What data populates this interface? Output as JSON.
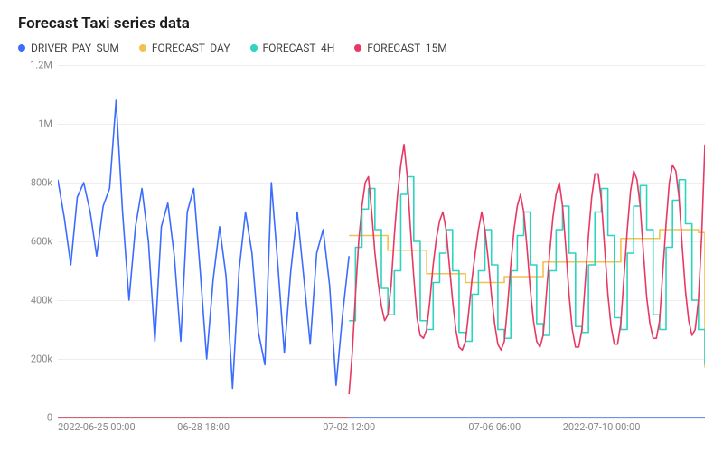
{
  "chart_data": {
    "type": "line",
    "title": "Forecast Taxi series data",
    "ylabel": "",
    "xlabel": "",
    "ylim": [
      0,
      1200000
    ],
    "y_ticks": [
      0,
      200000,
      400000,
      600000,
      800000,
      1000000,
      1200000
    ],
    "y_tick_labels": [
      "0",
      "200k",
      "400k",
      "600k",
      "800k",
      "1M",
      "1.2M"
    ],
    "x_ticks": [
      "2022-06-25 00:00",
      "06-28 18:00",
      "07-02 12:00",
      "07-06 06:00",
      "2022-07-10 00:00"
    ],
    "x_range_hours": 400,
    "legend_position": "top",
    "grid": true,
    "series": [
      {
        "name": "DRIVER_PAY_SUM",
        "color": "#3b6cff",
        "x_hours": [
          0,
          4,
          8,
          12,
          16,
          20,
          24,
          28,
          32,
          36,
          40,
          44,
          48,
          52,
          56,
          60,
          64,
          68,
          72,
          76,
          80,
          84,
          88,
          92,
          96,
          100,
          104,
          108,
          112,
          116,
          120,
          124,
          128,
          132,
          136,
          140,
          144,
          148,
          152,
          156,
          160,
          164,
          168,
          172,
          176,
          180
        ],
        "values": [
          810000,
          680000,
          520000,
          750000,
          800000,
          700000,
          550000,
          720000,
          780000,
          1080000,
          700000,
          400000,
          650000,
          780000,
          600000,
          260000,
          650000,
          730000,
          550000,
          260000,
          700000,
          780000,
          500000,
          200000,
          470000,
          650000,
          480000,
          100000,
          500000,
          700000,
          560000,
          290000,
          180000,
          800000,
          520000,
          220000,
          500000,
          700000,
          480000,
          250000,
          560000,
          640000,
          450000,
          110000,
          350000,
          550000
        ]
      },
      {
        "name": "FORECAST_DAY",
        "color": "#f2c14e",
        "step": true,
        "x_hours": [
          180,
          204,
          228,
          252,
          276,
          300,
          324,
          348,
          372,
          396,
          400
        ],
        "values": [
          620000,
          570000,
          490000,
          460000,
          480000,
          530000,
          530000,
          610000,
          640000,
          630000,
          170000
        ]
      },
      {
        "name": "FORECAST_4H",
        "color": "#2dd4bf",
        "step": true,
        "x_hours": [
          180,
          184,
          188,
          192,
          196,
          200,
          204,
          208,
          212,
          216,
          220,
          224,
          228,
          232,
          236,
          240,
          244,
          248,
          252,
          256,
          260,
          264,
          268,
          272,
          276,
          280,
          284,
          288,
          292,
          296,
          300,
          304,
          308,
          312,
          316,
          320,
          324,
          328,
          332,
          336,
          340,
          344,
          348,
          352,
          356,
          360,
          364,
          368,
          372,
          376,
          380,
          384,
          388,
          392,
          396,
          400
        ],
        "values": [
          330000,
          580000,
          710000,
          780000,
          640000,
          440000,
          350000,
          500000,
          760000,
          820000,
          600000,
          330000,
          300000,
          460000,
          560000,
          640000,
          500000,
          290000,
          260000,
          420000,
          500000,
          640000,
          520000,
          300000,
          270000,
          500000,
          620000,
          700000,
          520000,
          320000,
          280000,
          500000,
          640000,
          720000,
          560000,
          310000,
          290000,
          520000,
          700000,
          780000,
          620000,
          340000,
          300000,
          560000,
          720000,
          790000,
          640000,
          350000,
          300000,
          580000,
          740000,
          810000,
          660000,
          400000,
          300000,
          180000
        ]
      },
      {
        "name": "FORECAST_15M",
        "color": "#e63963",
        "x_hours": [
          180,
          182,
          184,
          186,
          188,
          190,
          192,
          194,
          196,
          198,
          200,
          202,
          204,
          206,
          208,
          210,
          212,
          214,
          216,
          218,
          220,
          222,
          224,
          226,
          228,
          230,
          232,
          234,
          236,
          238,
          240,
          242,
          244,
          246,
          248,
          250,
          252,
          254,
          256,
          258,
          260,
          262,
          264,
          266,
          268,
          270,
          272,
          274,
          276,
          278,
          280,
          282,
          284,
          286,
          288,
          290,
          292,
          294,
          296,
          298,
          300,
          302,
          304,
          306,
          308,
          310,
          312,
          314,
          316,
          318,
          320,
          322,
          324,
          326,
          328,
          330,
          332,
          334,
          336,
          338,
          340,
          342,
          344,
          346,
          348,
          350,
          352,
          354,
          356,
          358,
          360,
          362,
          364,
          366,
          368,
          370,
          372,
          374,
          376,
          378,
          380,
          382,
          384,
          386,
          388,
          390,
          392,
          394,
          396,
          398,
          400
        ],
        "values": [
          80000,
          220000,
          420000,
          600000,
          720000,
          800000,
          820000,
          700000,
          560000,
          460000,
          380000,
          330000,
          350000,
          450000,
          620000,
          760000,
          860000,
          930000,
          820000,
          640000,
          480000,
          340000,
          280000,
          270000,
          300000,
          400000,
          520000,
          610000,
          670000,
          700000,
          640000,
          520000,
          400000,
          300000,
          240000,
          230000,
          260000,
          360000,
          470000,
          560000,
          640000,
          700000,
          640000,
          540000,
          420000,
          320000,
          250000,
          230000,
          260000,
          380000,
          520000,
          640000,
          720000,
          760000,
          700000,
          580000,
          440000,
          330000,
          260000,
          240000,
          280000,
          420000,
          560000,
          680000,
          760000,
          800000,
          720000,
          580000,
          420000,
          300000,
          240000,
          240000,
          300000,
          460000,
          620000,
          750000,
          830000,
          830000,
          740000,
          580000,
          420000,
          310000,
          250000,
          250000,
          320000,
          480000,
          640000,
          770000,
          840000,
          810000,
          720000,
          560000,
          410000,
          320000,
          270000,
          270000,
          330000,
          500000,
          660000,
          800000,
          860000,
          840000,
          750000,
          580000,
          430000,
          330000,
          280000,
          300000,
          400000,
          620000,
          930000
        ]
      }
    ]
  }
}
